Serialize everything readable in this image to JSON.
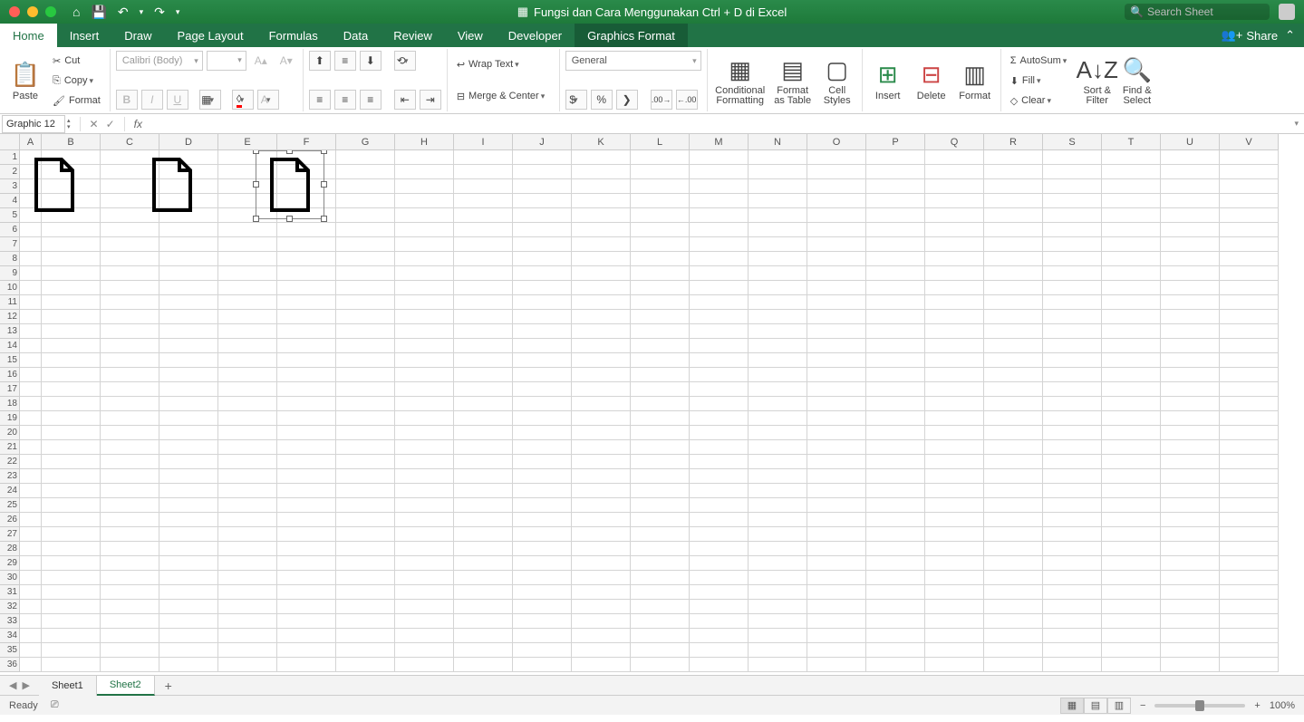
{
  "title": "Fungsi dan Cara Menggunakan Ctrl + D di Excel",
  "search_placeholder": "Search Sheet",
  "tabs": [
    "Home",
    "Insert",
    "Draw",
    "Page Layout",
    "Formulas",
    "Data",
    "Review",
    "View",
    "Developer",
    "Graphics Format"
  ],
  "active_tab": "Home",
  "dark_tab": "Graphics Format",
  "share_label": "Share",
  "ribbon": {
    "paste": "Paste",
    "cut": "Cut",
    "copy": "Copy",
    "format_painter": "Format",
    "font_name": "Calibri (Body)",
    "font_size": "",
    "bold": "B",
    "italic": "I",
    "underline": "U",
    "wrap_text": "Wrap Text",
    "merge_center": "Merge & Center",
    "number_format": "General",
    "cond_fmt": "Conditional Formatting",
    "fmt_table": "Format as Table",
    "cell_styles": "Cell Styles",
    "insert": "Insert",
    "delete": "Delete",
    "format": "Format",
    "autosum": "AutoSum",
    "fill": "Fill",
    "clear": "Clear",
    "sort_filter": "Sort & Filter",
    "find_select": "Find & Select"
  },
  "name_box": "Graphic 12",
  "columns": [
    "A",
    "B",
    "C",
    "D",
    "E",
    "F",
    "G",
    "H",
    "I",
    "J",
    "K",
    "L",
    "M",
    "N",
    "O",
    "P",
    "Q",
    "R",
    "S",
    "T",
    "U",
    "V"
  ],
  "rows": 36,
  "sheets": [
    "Sheet1",
    "Sheet2"
  ],
  "active_sheet": "Sheet2",
  "status": "Ready",
  "zoom": "100%"
}
